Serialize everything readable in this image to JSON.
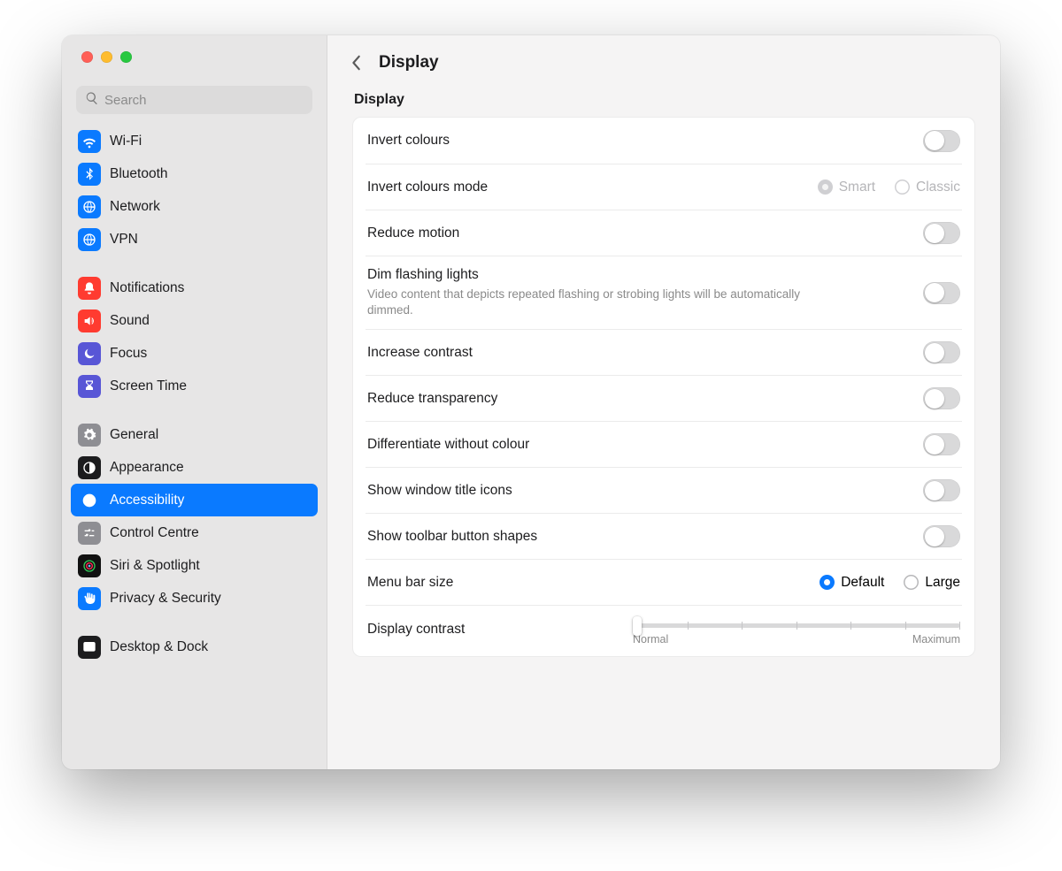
{
  "search": {
    "placeholder": "Search"
  },
  "sidebar": {
    "groups": [
      [
        {
          "label": "Wi-Fi",
          "icon": "wifi",
          "bg": "#0A7AFF"
        },
        {
          "label": "Bluetooth",
          "icon": "bluetooth",
          "bg": "#0A7AFF"
        },
        {
          "label": "Network",
          "icon": "globe",
          "bg": "#0A7AFF"
        },
        {
          "label": "VPN",
          "icon": "globe",
          "bg": "#0A7AFF"
        }
      ],
      [
        {
          "label": "Notifications",
          "icon": "bell",
          "bg": "#FF3B30"
        },
        {
          "label": "Sound",
          "icon": "speaker",
          "bg": "#FF3B30"
        },
        {
          "label": "Focus",
          "icon": "moon",
          "bg": "#5856D6"
        },
        {
          "label": "Screen Time",
          "icon": "hourglass",
          "bg": "#5856D6"
        }
      ],
      [
        {
          "label": "General",
          "icon": "gear",
          "bg": "#8E8E93"
        },
        {
          "label": "Appearance",
          "icon": "contrast",
          "bg": "#1C1C1E"
        },
        {
          "label": "Accessibility",
          "icon": "access",
          "bg": "#0A7AFF",
          "selected": true
        },
        {
          "label": "Control Centre",
          "icon": "sliders",
          "bg": "#8E8E93"
        },
        {
          "label": "Siri & Spotlight",
          "icon": "siri",
          "bg": "#111111"
        },
        {
          "label": "Privacy & Security",
          "icon": "hand",
          "bg": "#0A7AFF"
        }
      ],
      [
        {
          "label": "Desktop & Dock",
          "icon": "dock",
          "bg": "#1C1C1E"
        }
      ]
    ]
  },
  "page": {
    "title": "Display",
    "section": "Display",
    "rows": {
      "invert": {
        "label": "Invert colours",
        "on": false
      },
      "invertMode": {
        "label": "Invert colours mode",
        "options": [
          "Smart",
          "Classic"
        ],
        "value": "Smart",
        "disabled": true
      },
      "motion": {
        "label": "Reduce motion",
        "on": false
      },
      "dimFlash": {
        "label": "Dim flashing lights",
        "sub": "Video content that depicts repeated flashing or strobing lights will be automatically dimmed.",
        "on": false
      },
      "contrast": {
        "label": "Increase contrast",
        "on": false
      },
      "transparency": {
        "label": "Reduce transparency",
        "on": false
      },
      "diffColour": {
        "label": "Differentiate without colour",
        "on": false
      },
      "titleIcons": {
        "label": "Show window title icons",
        "on": false
      },
      "toolbarShapes": {
        "label": "Show toolbar button shapes",
        "on": false
      },
      "menuBarSize": {
        "label": "Menu bar size",
        "options": [
          "Default",
          "Large"
        ],
        "value": "Default"
      },
      "displayContrast": {
        "label": "Display contrast",
        "min": "Normal",
        "max": "Maximum",
        "value": 0
      }
    }
  }
}
